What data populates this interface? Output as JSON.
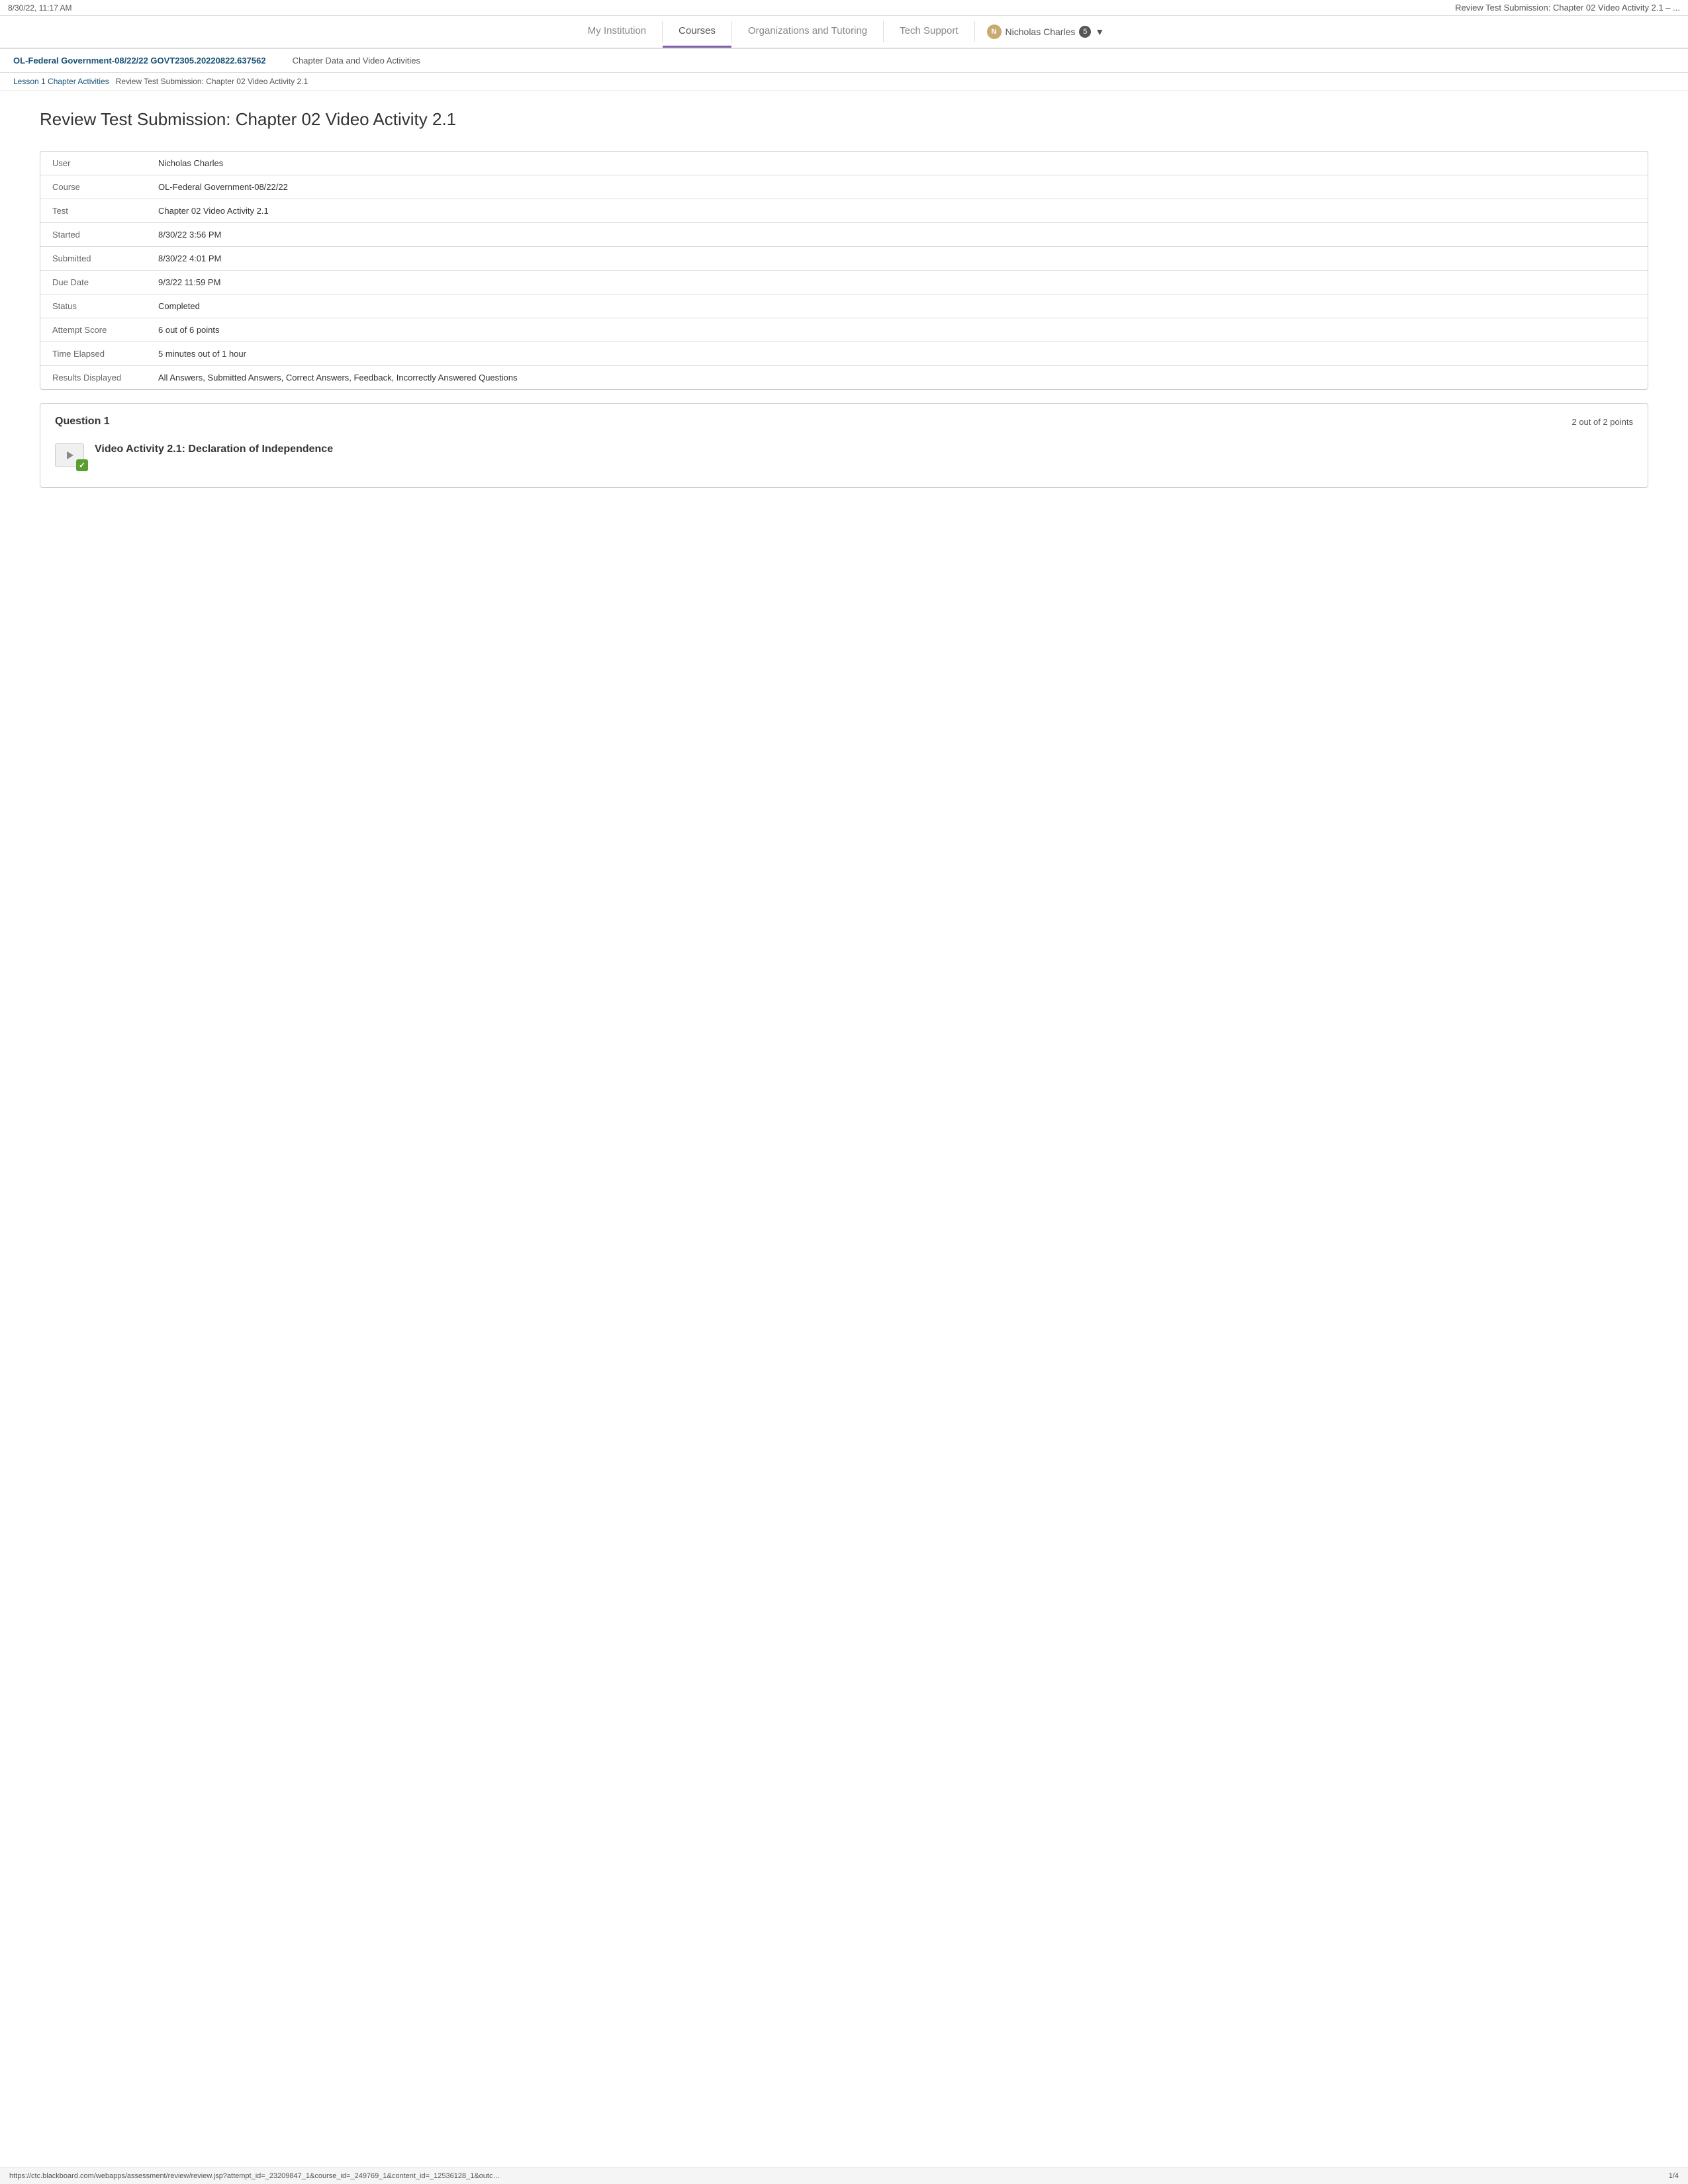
{
  "browser": {
    "datetime": "8/30/22, 11:17 AM",
    "tab_title": "Review Test Submission: Chapter 02 Video Activity 2.1 – ..."
  },
  "nav": {
    "my_institution": "My Institution",
    "courses": "Courses",
    "organizations": "Organizations and Tutoring",
    "tech_support": "Tech Support",
    "user_name": "Nicholas Charles",
    "badge_count": "5"
  },
  "course_header": {
    "course_title": "OL-Federal Government-08/22/22 GOVT2305.20220822.637562",
    "section_link": "Chapter Data and Video Activities"
  },
  "breadcrumb": {
    "item1": "Lesson 1 Chapter Activities",
    "item2": "Review Test Submission: Chapter 02 Video Activity 2.1"
  },
  "page": {
    "title": "Review Test Submission: Chapter 02 Video Activity 2.1"
  },
  "details": {
    "rows": [
      {
        "label": "User",
        "value": "Nicholas Charles"
      },
      {
        "label": "Course",
        "value": "OL-Federal Government-08/22/22"
      },
      {
        "label": "Test",
        "value": "Chapter 02 Video Activity 2.1"
      },
      {
        "label": "Started",
        "value": "8/30/22 3:56 PM"
      },
      {
        "label": "Submitted",
        "value": "8/30/22 4:01 PM"
      },
      {
        "label": "Due Date",
        "value": "9/3/22 11:59 PM"
      },
      {
        "label": "Status",
        "value": "Completed"
      },
      {
        "label": "Attempt Score",
        "value": "6 out of 6 points"
      },
      {
        "label": "Time Elapsed",
        "value": "5 minutes out of 1 hour"
      },
      {
        "label": "Results Displayed",
        "value": "All Answers, Submitted Answers, Correct Answers, Feedback, Incorrectly Answered Questions"
      }
    ]
  },
  "question1": {
    "label": "Question 1",
    "points": "2 out of 2 points",
    "title": "Video Activity 2.1: Declaration of Independence"
  },
  "footer": {
    "url": "https://ctc.blackboard.com/webapps/assessment/review/review.jsp?attempt_id=_23209847_1&course_id=_249769_1&content_id=_12536128_1&outc…",
    "page": "1/4"
  }
}
